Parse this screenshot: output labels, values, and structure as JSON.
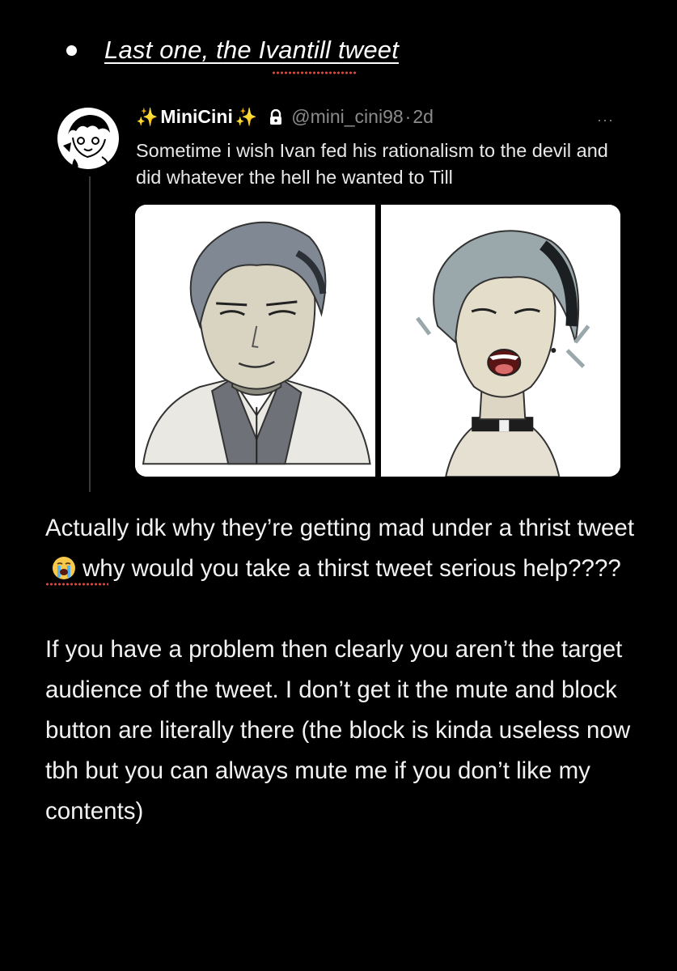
{
  "bullet": {
    "link_text": "Last one, the Ivantill tweet"
  },
  "quoted_tweet": {
    "sparkle_left": "✨",
    "display_name": "MiniCini",
    "sparkle_right": "✨",
    "handle": "@mini_cini98",
    "separator": "·",
    "time": "2d",
    "more": "···",
    "text": "Sometime i wish Ivan fed his rationalism to the devil and did whatever the hell he wanted to Till",
    "media_count": 2
  },
  "body": {
    "paragraph1_part1": "Actually idk why they’re getting mad under a thrist tweet",
    "paragraph1_part2": "why would you take a thirst tweet serious help????",
    "paragraph2": "If you have a problem then clearly you aren’t the target audience of the tweet. I don’t get it the mute and block button are literally there (the block is kinda useless now tbh but you can always mute me if you don’t like my contents)"
  },
  "colors": {
    "background": "#000000",
    "text": "#ffffff",
    "muted": "#8b8b8b",
    "sparkle": "#f7c84a",
    "spellcheck": "#e0483e"
  },
  "icons": {
    "bullet": "bullet-dot",
    "lock": "lock-icon",
    "more": "more-icon",
    "crying": "loudly-crying-face-emoji"
  }
}
